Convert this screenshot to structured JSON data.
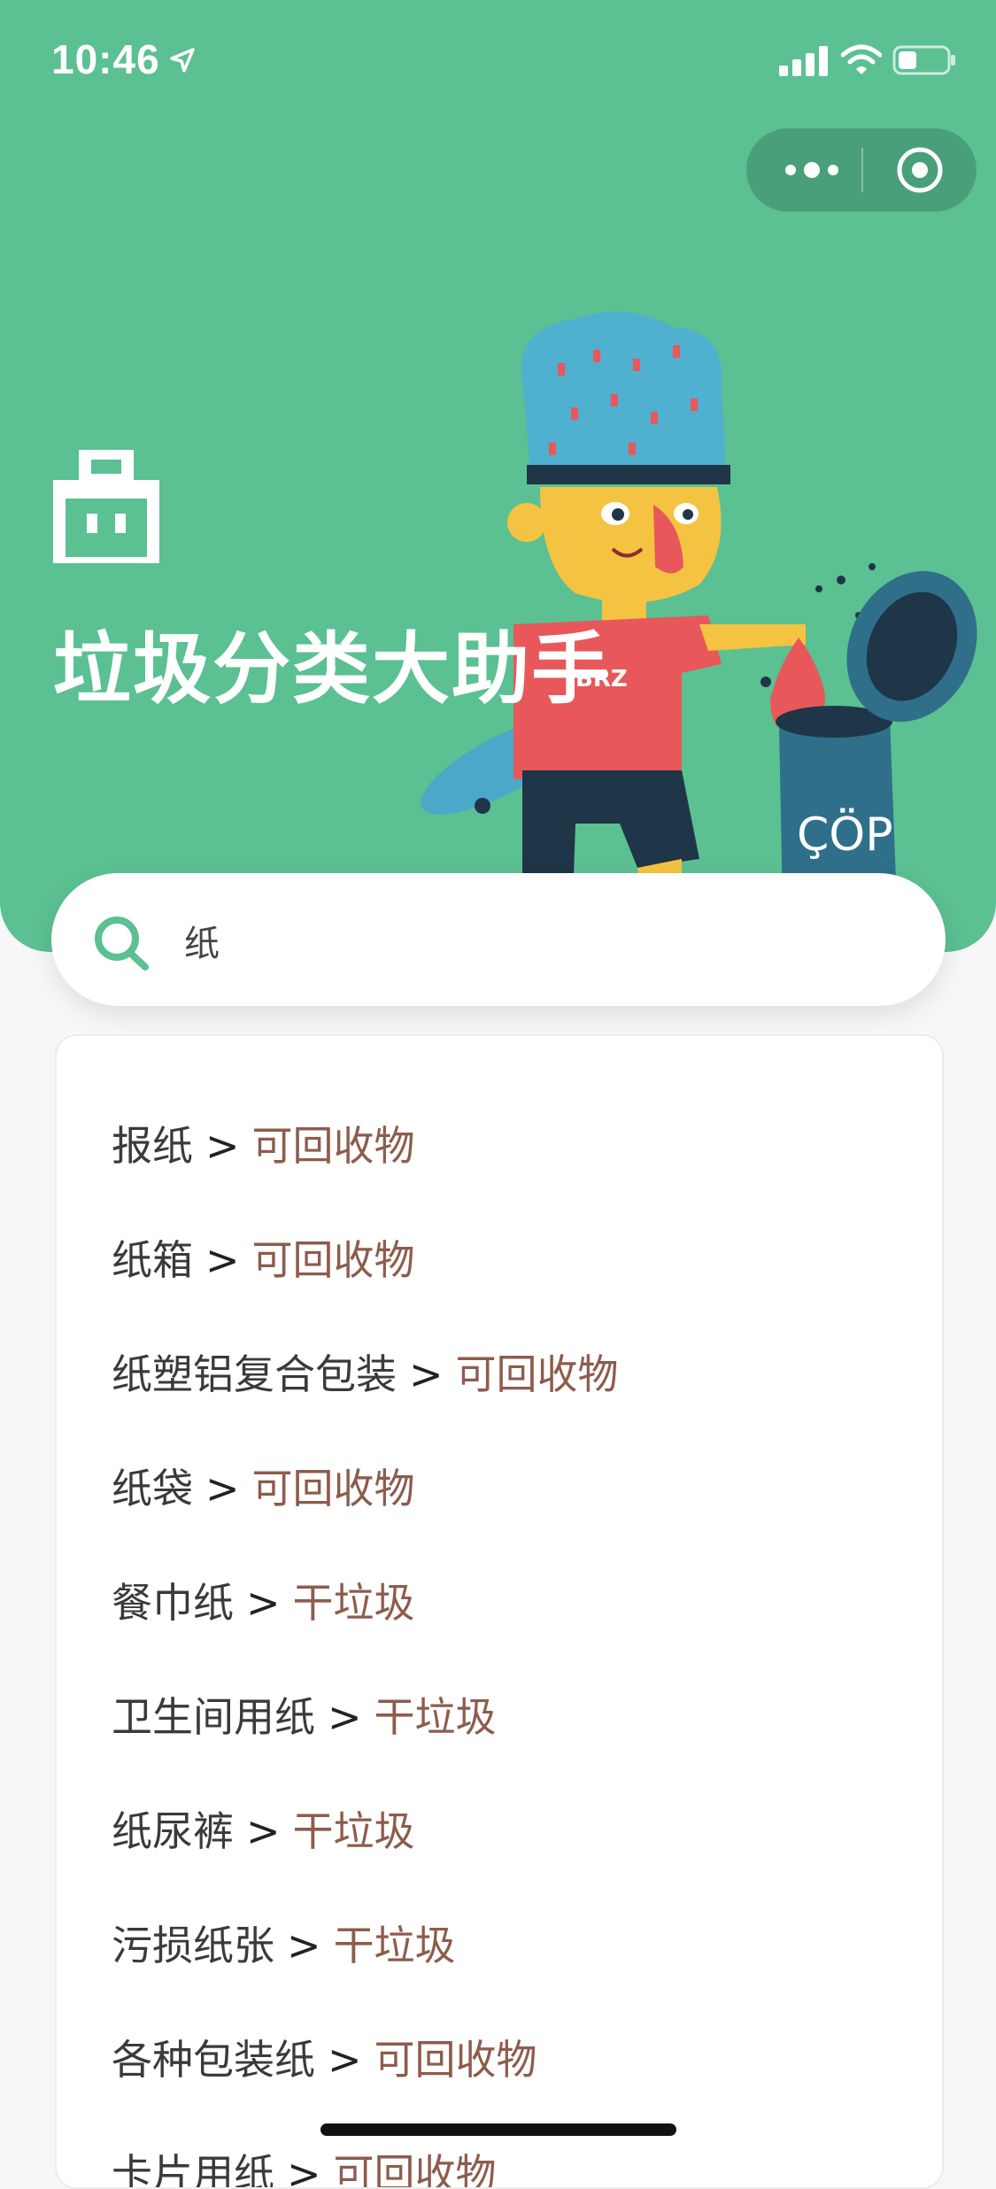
{
  "status_bar": {
    "time": "10:46"
  },
  "header": {
    "title": "垃圾分类大助手",
    "background_color": "#5bc092"
  },
  "search": {
    "value": "纸",
    "accent_color": "#5bc092"
  },
  "results": [
    {
      "item": "报纸",
      "separator": ">",
      "category": "可回收物"
    },
    {
      "item": "纸箱",
      "separator": ">",
      "category": "可回收物"
    },
    {
      "item": "纸塑铝复合包装",
      "separator": ">",
      "category": "可回收物"
    },
    {
      "item": "纸袋",
      "separator": ">",
      "category": "可回收物"
    },
    {
      "item": "餐巾纸",
      "separator": ">",
      "category": "干垃圾"
    },
    {
      "item": "卫生间用纸",
      "separator": ">",
      "category": "干垃圾"
    },
    {
      "item": "纸尿裤",
      "separator": ">",
      "category": "干垃圾"
    },
    {
      "item": "污损纸张",
      "separator": ">",
      "category": "干垃圾"
    },
    {
      "item": "各种包装纸",
      "separator": ">",
      "category": "可回收物"
    },
    {
      "item": "卡片用纸",
      "separator": ">",
      "category": "可回收物"
    }
  ],
  "category_color": "#8d5c4c",
  "icons": [
    "location-arrow-icon",
    "signal-icon",
    "wifi-icon",
    "battery-icon",
    "more-icon",
    "close-target-icon",
    "trash-bin-icon",
    "search-icon"
  ]
}
